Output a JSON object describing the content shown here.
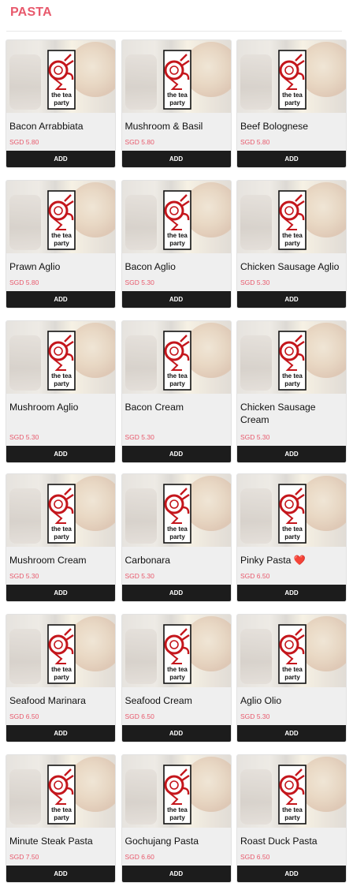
{
  "section": {
    "title": "PASTA"
  },
  "colors": {
    "accent": "#e8596c",
    "button_bg": "#1c1c1c",
    "card_bg": "#efefef"
  },
  "logo": {
    "line1": "the tea",
    "line2": "party"
  },
  "items": [
    {
      "name": "Bacon Arrabbiata",
      "price": "SGD 5.80",
      "button": "ADD"
    },
    {
      "name": "Mushroom & Basil",
      "price": "SGD 5.80",
      "button": "ADD"
    },
    {
      "name": "Beef Bolognese",
      "price": "SGD 5.80",
      "button": "ADD"
    },
    {
      "name": "Prawn Aglio",
      "price": "SGD 5.80",
      "button": "ADD"
    },
    {
      "name": "Bacon Aglio",
      "price": "SGD 5.30",
      "button": "ADD"
    },
    {
      "name": "Chicken Sausage Aglio",
      "price": "SGD 5.30",
      "button": "ADD"
    },
    {
      "name": "Mushroom Aglio",
      "price": "SGD 5.30",
      "button": "ADD"
    },
    {
      "name": "Bacon Cream",
      "price": "SGD 5.30",
      "button": "ADD"
    },
    {
      "name": "Chicken Sausage Cream",
      "price": "SGD 5.30",
      "button": "ADD"
    },
    {
      "name": "Mushroom Cream",
      "price": "SGD 5.30",
      "button": "ADD"
    },
    {
      "name": "Carbonara",
      "price": "SGD 5.30",
      "button": "ADD"
    },
    {
      "name": "Pinky Pasta ❤️",
      "price": "SGD 6.50",
      "button": "ADD"
    },
    {
      "name": "Seafood Marinara",
      "price": "SGD 6.50",
      "button": "ADD"
    },
    {
      "name": "Seafood Cream",
      "price": "SGD 6.50",
      "button": "ADD"
    },
    {
      "name": "Aglio Olio",
      "price": "SGD 5.30",
      "button": "ADD"
    },
    {
      "name": "Minute Steak Pasta",
      "price": "SGD 7.50",
      "button": "ADD"
    },
    {
      "name": "Gochujang Pasta",
      "price": "SGD 6.60",
      "button": "ADD"
    },
    {
      "name": "Roast Duck Pasta",
      "price": "SGD 6.50",
      "button": "ADD"
    }
  ]
}
